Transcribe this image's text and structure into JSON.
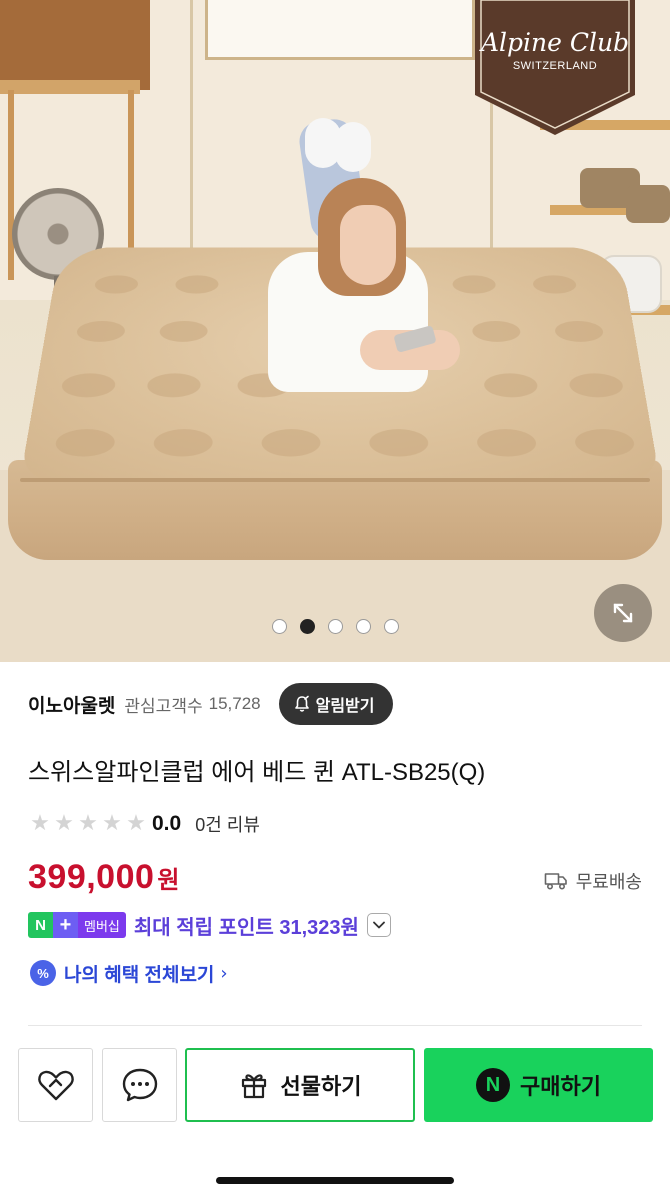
{
  "hero": {
    "brand_logo_main": "Alpine Club",
    "brand_logo_sub": "SWITZERLAND",
    "image_count": 5,
    "active_image": 2
  },
  "store": {
    "name": "이노아울렛",
    "watchers_label": "관심고객수",
    "watchers_count": "15,728",
    "notify_label": "알림받기"
  },
  "product": {
    "title": "스위스알파인클럽 에어 베드 퀸 ATL-SB25(Q)",
    "rating": "0.0",
    "review_count": "0건 리뷰",
    "stars_filled": 0,
    "stars_total": 5,
    "price": "399,000",
    "price_unit": "원",
    "shipping": "무료배송"
  },
  "points": {
    "badge_n": "N",
    "badge_plus": "+",
    "badge_label": "멤버십",
    "text": "최대 적립 포인트 31,323원"
  },
  "benefits": {
    "icon": "%",
    "text": "나의 혜택 전체보기",
    "chevron": "›"
  },
  "actions": {
    "gift_label": "선물하기",
    "buy_label": "구매하기",
    "buy_badge": "N"
  },
  "colors": {
    "price": "#c8102e",
    "points": "#5b3fd9",
    "benefit": "#2b47d6",
    "buy_button": "#19d25c",
    "logo_badge": "#5a3a2a"
  },
  "icons": [
    "expand-icon",
    "bell-icon",
    "truck-icon",
    "chevron-down-icon",
    "heart-icon",
    "chat-icon",
    "gift-icon"
  ]
}
